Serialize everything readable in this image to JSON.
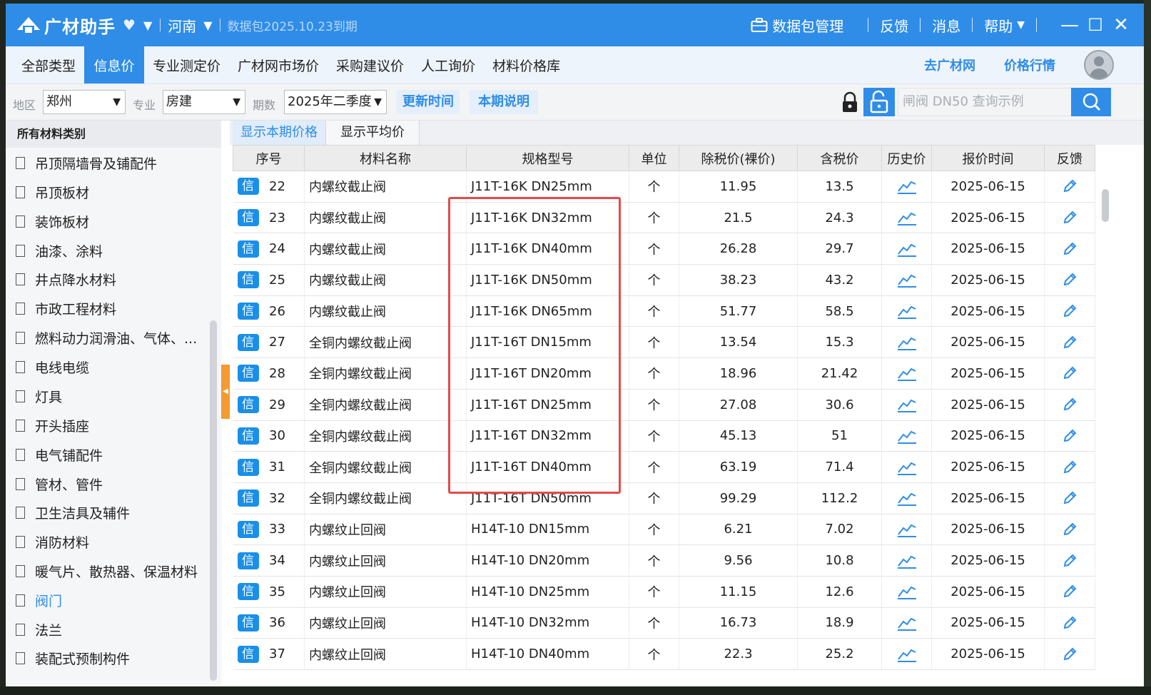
{
  "app": {
    "title": "广材助手",
    "region": "河南",
    "package_info": "数据包2025.10.23到期",
    "data_mgmt": "数据包管理",
    "feedback": "反馈",
    "messages": "消息",
    "help": "帮助"
  },
  "nav": {
    "tabs": [
      {
        "label": "全部类型"
      },
      {
        "label": "信息价"
      },
      {
        "label": "专业测定价"
      },
      {
        "label": "广材网市场价"
      },
      {
        "label": "采购建议价"
      },
      {
        "label": "人工询价"
      },
      {
        "label": "材料价格库"
      }
    ],
    "goto_site": "去广材网",
    "price_trend": "价格行情"
  },
  "filters": {
    "area_label": "地区",
    "area_value": "郑州",
    "major_label": "专业",
    "major_value": "房建",
    "period_label": "期数",
    "period_value": "2025年二季度",
    "update_time_btn": "更新时间",
    "period_note_btn": "本期说明",
    "search_placeholder": "闸阀 DN50 查询示例"
  },
  "sidebar": {
    "header": "所有材料类别",
    "items": [
      {
        "label": "吊顶隔墙骨及铺配件"
      },
      {
        "label": "吊顶板材"
      },
      {
        "label": "装饰板材"
      },
      {
        "label": "油漆、涂料"
      },
      {
        "label": "井点降水材料"
      },
      {
        "label": "市政工程材料"
      },
      {
        "label": "燃料动力润滑油、气体、..."
      },
      {
        "label": "电线电缆"
      },
      {
        "label": "灯具"
      },
      {
        "label": "开头插座"
      },
      {
        "label": "电气铺配件"
      },
      {
        "label": "管材、管件"
      },
      {
        "label": "卫生洁具及辅件"
      },
      {
        "label": "消防材料"
      },
      {
        "label": "暖气片、散热器、保温材料"
      },
      {
        "label": "阀门"
      },
      {
        "label": "法兰"
      },
      {
        "label": "装配式预制构件"
      }
    ],
    "active_item": "阀门"
  },
  "subtabs": {
    "current": "显示本期价格",
    "average": "显示平均价"
  },
  "table": {
    "headers": [
      "序号",
      "材料名称",
      "规格型号",
      "单位",
      "除税价(裸价)",
      "含税价",
      "历史价",
      "报价时间",
      "反馈"
    ],
    "badge": "信",
    "rows": [
      {
        "seq": "22",
        "name": "内螺纹截止阀",
        "spec": "J11T-16K DN25mm",
        "unit": "个",
        "pretax": "11.95",
        "taxed": "13.5",
        "date": "2025-06-15"
      },
      {
        "seq": "23",
        "name": "内螺纹截止阀",
        "spec": "J11T-16K DN32mm",
        "unit": "个",
        "pretax": "21.5",
        "taxed": "24.3",
        "date": "2025-06-15"
      },
      {
        "seq": "24",
        "name": "内螺纹截止阀",
        "spec": "J11T-16K DN40mm",
        "unit": "个",
        "pretax": "26.28",
        "taxed": "29.7",
        "date": "2025-06-15"
      },
      {
        "seq": "25",
        "name": "内螺纹截止阀",
        "spec": "J11T-16K DN50mm",
        "unit": "个",
        "pretax": "38.23",
        "taxed": "43.2",
        "date": "2025-06-15"
      },
      {
        "seq": "26",
        "name": "内螺纹截止阀",
        "spec": "J11T-16K DN65mm",
        "unit": "个",
        "pretax": "51.77",
        "taxed": "58.5",
        "date": "2025-06-15"
      },
      {
        "seq": "27",
        "name": "全铜内螺纹截止阀",
        "spec": "J11T-16T DN15mm",
        "unit": "个",
        "pretax": "13.54",
        "taxed": "15.3",
        "date": "2025-06-15"
      },
      {
        "seq": "28",
        "name": "全铜内螺纹截止阀",
        "spec": "J11T-16T DN20mm",
        "unit": "个",
        "pretax": "18.96",
        "taxed": "21.42",
        "date": "2025-06-15"
      },
      {
        "seq": "29",
        "name": "全铜内螺纹截止阀",
        "spec": "J11T-16T DN25mm",
        "unit": "个",
        "pretax": "27.08",
        "taxed": "30.6",
        "date": "2025-06-15"
      },
      {
        "seq": "30",
        "name": "全铜内螺纹截止阀",
        "spec": "J11T-16T DN32mm",
        "unit": "个",
        "pretax": "45.13",
        "taxed": "51",
        "date": "2025-06-15"
      },
      {
        "seq": "31",
        "name": "全铜内螺纹截止阀",
        "spec": "J11T-16T DN40mm",
        "unit": "个",
        "pretax": "63.19",
        "taxed": "71.4",
        "date": "2025-06-15"
      },
      {
        "seq": "32",
        "name": "全铜内螺纹截止阀",
        "spec": "J11T-16T DN50mm",
        "unit": "个",
        "pretax": "99.29",
        "taxed": "112.2",
        "date": "2025-06-15"
      },
      {
        "seq": "33",
        "name": "内螺纹止回阀",
        "spec": "H14T-10 DN15mm",
        "unit": "个",
        "pretax": "6.21",
        "taxed": "7.02",
        "date": "2025-06-15"
      },
      {
        "seq": "34",
        "name": "内螺纹止回阀",
        "spec": "H14T-10 DN20mm",
        "unit": "个",
        "pretax": "9.56",
        "taxed": "10.8",
        "date": "2025-06-15"
      },
      {
        "seq": "35",
        "name": "内螺纹止回阀",
        "spec": "H14T-10 DN25mm",
        "unit": "个",
        "pretax": "11.15",
        "taxed": "12.6",
        "date": "2025-06-15"
      },
      {
        "seq": "36",
        "name": "内螺纹止回阀",
        "spec": "H14T-10 DN32mm",
        "unit": "个",
        "pretax": "16.73",
        "taxed": "18.9",
        "date": "2025-06-15"
      },
      {
        "seq": "37",
        "name": "内螺纹止回阀",
        "spec": "H14T-10 DN40mm",
        "unit": "个",
        "pretax": "22.3",
        "taxed": "25.2",
        "date": "2025-06-15"
      }
    ]
  },
  "colors": {
    "brand_blue": "#2f8de8",
    "highlight_red": "#e24b4b",
    "handle_orange": "#f39a32"
  },
  "icons": {
    "history": "line-chart-icon",
    "feedback": "pencil-icon"
  }
}
